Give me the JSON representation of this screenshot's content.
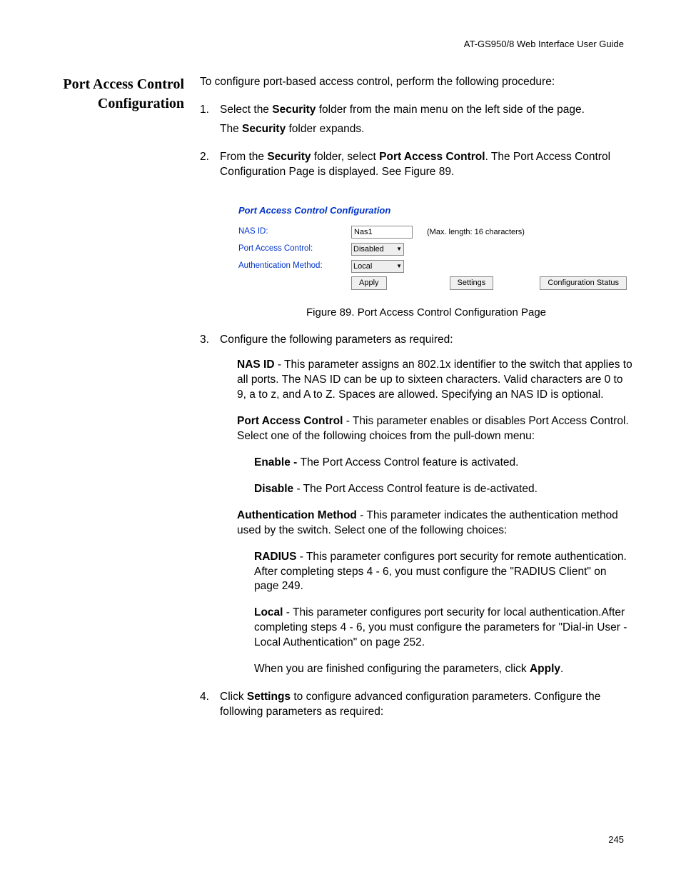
{
  "header": "AT-GS950/8  Web Interface User Guide",
  "side_heading": "Port Access Control Configuration",
  "intro": "To configure port-based access control, perform the following procedure:",
  "step1": {
    "num": "1.",
    "line1a": "Select the ",
    "line1b": "Security",
    "line1c": " folder from the main menu on the left side of the page.",
    "line2a": "The ",
    "line2b": "Security",
    "line2c": " folder expands."
  },
  "step2": {
    "num": "2.",
    "a": "From the ",
    "b": "Security",
    "c": " folder, select ",
    "d": "Port Access Control",
    "e": ". The Port Access Control Configuration Page is displayed. See Figure 89."
  },
  "figure": {
    "title": "Port Access Control Configuration",
    "r1_label": "NAS ID:",
    "r1_value": "Nas1",
    "r1_hint": "(Max. length: 16 characters)",
    "r2_label": "Port Access Control:",
    "r2_value": "Disabled",
    "r3_label": "Authentication Method:",
    "r3_value": "Local",
    "btn_apply": "Apply",
    "btn_settings": "Settings",
    "btn_cfg": "Configuration Status",
    "caption": "Figure 89. Port Access Control Configuration Page"
  },
  "step3": {
    "num": "3.",
    "lead": "Configure the following parameters as required:",
    "nasid_b": "NAS ID",
    "nasid_t": " - This parameter assigns an 802.1x identifier to the switch that applies to all ports. The NAS ID can be up to sixteen characters. Valid characters are 0 to 9, a to z, and A to Z. Spaces are allowed. Specifying an NAS ID is optional.",
    "pac_b": "Port Access Control",
    "pac_t": " - This parameter enables or disables Port Access Control. Select one of the following choices from the pull-down menu:",
    "enable_b": "Enable - ",
    "enable_t": "The Port Access Control feature is activated.",
    "disable_b": "Disable",
    "disable_t": " - The Port Access Control feature is de-activated.",
    "auth_b": "Authentication Method",
    "auth_t": " - This parameter indicates the authentication method used by the switch. Select one of the following choices:",
    "radius_b": "RADIUS",
    "radius_t": " - This parameter configures port security for remote authentication. After completing steps 4 - 6, you must configure the \"RADIUS Client\" on page 249.",
    "local_b": "Local",
    "local_t": " - This parameter configures port security for local authentication.After completing steps 4 - 6, you must configure the parameters for \"Dial-in User - Local Authentication\" on page 252.",
    "finish_a": "When you are finished configuring the parameters, click ",
    "finish_b": "Apply",
    "finish_c": "."
  },
  "step4": {
    "num": "4.",
    "a": "Click ",
    "b": "Settings",
    "c": " to configure advanced configuration parameters. Configure the following parameters as required:"
  },
  "page_number": "245"
}
